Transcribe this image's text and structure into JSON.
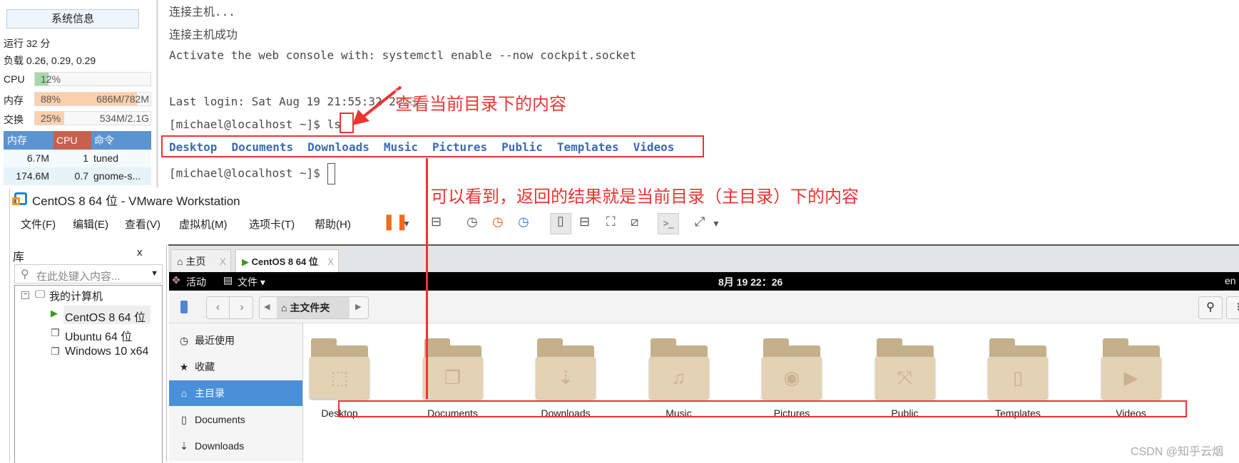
{
  "sysinfo": {
    "title": "系统信息",
    "uptime": "运行 32 分",
    "load": "负载 0.26, 0.29, 0.29",
    "cpu": {
      "label": "CPU",
      "percent": "12%",
      "fill": 12
    },
    "mem": {
      "label": "内存",
      "percent": "88%",
      "amount": "686M/782M",
      "fill": 88
    },
    "swap": {
      "label": "交换",
      "percent": "25%",
      "amount": "534M/2.1G",
      "fill": 25
    },
    "table": {
      "headers": [
        "内存",
        "CPU",
        "命令"
      ],
      "rows": [
        [
          "6.7M",
          "1",
          "tuned"
        ],
        [
          "174.6M",
          "0.7",
          "gnome-s..."
        ]
      ]
    }
  },
  "terminal": {
    "lines": [
      "连接主机...",
      "连接主机成功",
      "Activate the web console with: systemctl enable --now cockpit.socket",
      "Last login: Sat Aug 19 21:55:32 2023"
    ],
    "prompt": "[michael@localhost ~]$ ",
    "command": "ls",
    "ls_output": [
      "Desktop",
      "Documents",
      "Downloads",
      "Music",
      "Pictures",
      "Public",
      "Templates",
      "Videos"
    ]
  },
  "annotations": {
    "a1": "查看当前目录下的内容",
    "a2": "可以看到，返回的结果就是当前目录（主目录）下的内容",
    "color": "#ee3333"
  },
  "vmware": {
    "title": "CentOS 8 64 位 - VMware Workstation",
    "menu": [
      "文件(F)",
      "编辑(E)",
      "查看(V)",
      "虚拟机(M)",
      "选项卡(T)",
      "帮助(H)"
    ],
    "library": {
      "title": "库",
      "close": "x",
      "search_placeholder": "在此处键入内容...",
      "root": "我的计算机",
      "vms": [
        "CentOS 8 64 位",
        "Ubuntu 64 位",
        "Windows 10 x64"
      ]
    },
    "tabs": [
      {
        "label": "主页",
        "close": "X"
      },
      {
        "label": "CentOS 8 64 位",
        "close": "X"
      }
    ]
  },
  "guest": {
    "activities": "活动",
    "files_menu": "文件",
    "clock": "8月 19  22：26",
    "lang": "en",
    "path": "主文件夹",
    "sidebar": [
      "最近使用",
      "收藏",
      "主目录",
      "Documents",
      "Downloads"
    ],
    "folders": [
      "Desktop",
      "Documents",
      "Downloads",
      "Music",
      "Pictures",
      "Public",
      "Templates",
      "Videos"
    ]
  },
  "watermark": "CSDN @知乎云烟"
}
